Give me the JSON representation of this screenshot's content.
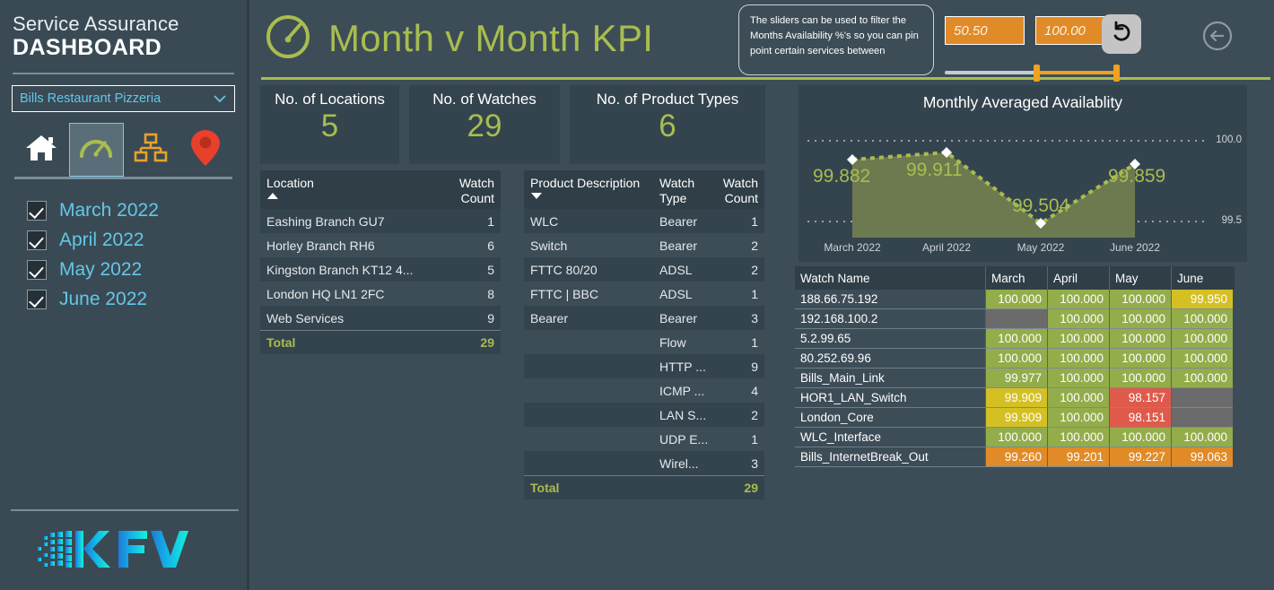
{
  "sidebar": {
    "brand_top": "Service Assurance",
    "brand_bottom": "DASHBOARD",
    "dropdown": {
      "value": "Bills Restaurant Pizzeria",
      "icon": "chevron-down-icon"
    },
    "nav_icons": [
      {
        "name": "home-icon",
        "label": "Home",
        "color": "#ffffff",
        "active": false
      },
      {
        "name": "gauge-icon",
        "label": "KPI",
        "color": "#a8bd4f",
        "active": true
      },
      {
        "name": "sitemap-icon",
        "label": "Topology",
        "color": "#e8a22a",
        "active": false
      },
      {
        "name": "map-pin-icon",
        "label": "Locations",
        "color": "#e8402a",
        "active": false
      }
    ],
    "months": [
      {
        "label": "March 2022",
        "checked": true
      },
      {
        "label": "April 2022",
        "checked": true
      },
      {
        "label": "May 2022",
        "checked": true
      },
      {
        "label": "June 2022",
        "checked": true
      }
    ],
    "logo_text": "KFV"
  },
  "header": {
    "title": "Month v Month KPI",
    "title_icon": "gauge-icon",
    "accent_color": "#a8bd4f",
    "tooltip": "The sliders can be used to filter the Months Availability %'s so you can pin point certain services between",
    "slider": {
      "min_value": "50.50",
      "max_value": "100.00",
      "color": "#e08b28"
    },
    "reset_button": {
      "name": "reset-button",
      "icon": "undo-arrow-icon"
    },
    "back_button": {
      "name": "back-button",
      "icon": "circle-left-arrow-icon"
    }
  },
  "kpi_cards": [
    {
      "title": "No. of Locations",
      "value": "5"
    },
    {
      "title": "No. of Watches",
      "value": "29"
    },
    {
      "title": "No. of Product Types",
      "value": "6"
    }
  ],
  "location_table": {
    "headers": [
      "Location",
      "Watch Count"
    ],
    "sort": "ascending",
    "rows": [
      {
        "location": "Eashing Branch GU7",
        "count": "1"
      },
      {
        "location": "Horley Branch RH6",
        "count": "6"
      },
      {
        "location": "Kingston Branch KT12 4...",
        "count": "5"
      },
      {
        "location": "London HQ LN1 2FC",
        "count": "8"
      },
      {
        "location": "Web Services",
        "count": "9"
      }
    ],
    "total_label": "Total",
    "total_value": "29"
  },
  "product_table": {
    "headers": [
      "Product Description",
      "Watch Type",
      "Watch Count"
    ],
    "sort": "descending",
    "rows": [
      {
        "desc": "WLC",
        "type": "Bearer",
        "count": "1"
      },
      {
        "desc": "Switch",
        "type": "Bearer",
        "count": "2"
      },
      {
        "desc": "FTTC 80/20",
        "type": "ADSL",
        "count": "2"
      },
      {
        "desc": "FTTC | BBC",
        "type": "ADSL",
        "count": "1"
      },
      {
        "desc": "Bearer",
        "type": "Bearer",
        "count": "3"
      },
      {
        "desc": "",
        "type": "Flow",
        "count": "1"
      },
      {
        "desc": "",
        "type": "HTTP ...",
        "count": "9"
      },
      {
        "desc": "",
        "type": "ICMP ...",
        "count": "4"
      },
      {
        "desc": "",
        "type": "LAN S...",
        "count": "2"
      },
      {
        "desc": "",
        "type": "UDP E...",
        "count": "1"
      },
      {
        "desc": "",
        "type": "Wirel...",
        "count": "3"
      }
    ],
    "total_label": "Total",
    "total_value": "29"
  },
  "chart_data": {
    "type": "area",
    "title": "Monthly Averaged Availablity",
    "categories": [
      "March 2022",
      "April 2022",
      "May 2022",
      "June 2022"
    ],
    "values": [
      99.882,
      99.911,
      99.504,
      99.859
    ],
    "labels": [
      "99.882",
      "99.911",
      "99.504",
      "99.859"
    ],
    "ylim": [
      99.5,
      100.0
    ],
    "ytick_labels": [
      "100.0",
      "99.5"
    ],
    "xlabel": "",
    "ylabel": "",
    "grid": true,
    "legend": "none",
    "line_color": "#a8bd4f",
    "fill_color": "#6d7a4f",
    "marker": "diamond",
    "marker_color": "#ffffff"
  },
  "matrix": {
    "headers": [
      "Watch Name",
      "March",
      "April",
      "May",
      "June"
    ],
    "rows": [
      {
        "name": "188.66.75.192",
        "values": [
          "100.000",
          "100.000",
          "100.000",
          "99.950"
        ]
      },
      {
        "name": "192.168.100.2",
        "values": [
          "",
          "100.000",
          "100.000",
          "100.000"
        ]
      },
      {
        "name": "5.2.99.65",
        "values": [
          "100.000",
          "100.000",
          "100.000",
          "100.000"
        ]
      },
      {
        "name": "80.252.69.96",
        "values": [
          "100.000",
          "100.000",
          "100.000",
          "100.000"
        ]
      },
      {
        "name": "Bills_Main_Link",
        "values": [
          "99.977",
          "100.000",
          "100.000",
          "100.000"
        ]
      },
      {
        "name": "HOR1_LAN_Switch",
        "values": [
          "99.909",
          "100.000",
          "98.157",
          ""
        ]
      },
      {
        "name": "London_Core",
        "values": [
          "99.909",
          "100.000",
          "98.151",
          ""
        ]
      },
      {
        "name": "WLC_Interface",
        "values": [
          "100.000",
          "100.000",
          "100.000",
          "100.000"
        ]
      },
      {
        "name": "Bills_InternetBreak_Out",
        "values": [
          "99.260",
          "99.201",
          "99.227",
          "99.063"
        ]
      }
    ],
    "colors": {
      "good": "#93ad4b",
      "warn": "#d4c023",
      "alert": "#e08b28",
      "bad": "#e05a4b",
      "empty": "#6b6b6b"
    }
  }
}
